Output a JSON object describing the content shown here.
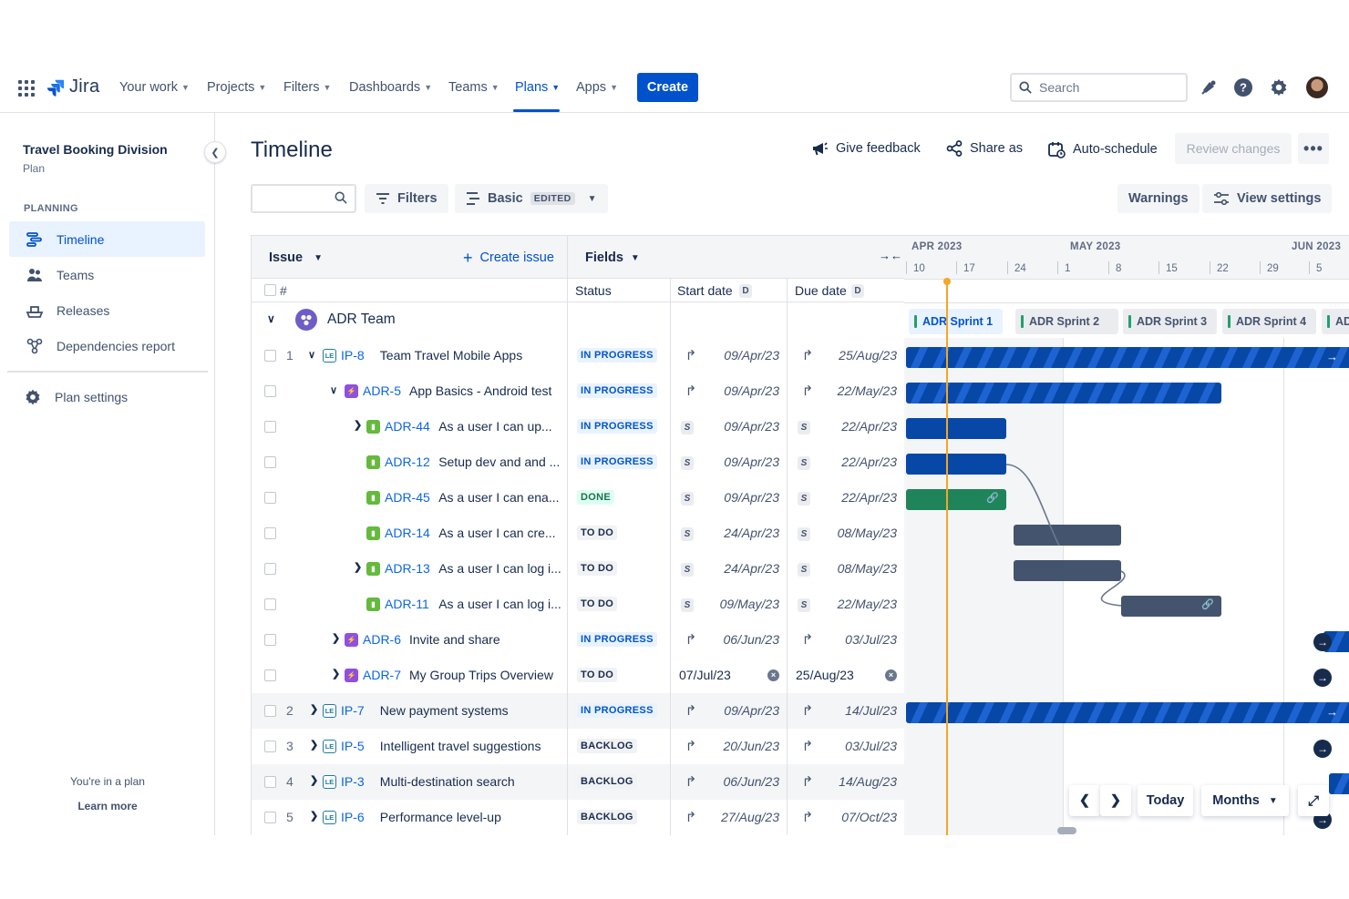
{
  "nav": {
    "app_name": "Jira",
    "items": [
      {
        "label": "Your work"
      },
      {
        "label": "Projects"
      },
      {
        "label": "Filters"
      },
      {
        "label": "Dashboards"
      },
      {
        "label": "Teams"
      },
      {
        "label": "Plans"
      },
      {
        "label": "Apps"
      }
    ],
    "create_label": "Create",
    "search_placeholder": "Search"
  },
  "sidebar": {
    "project_title": "Travel Booking Division",
    "project_type": "Plan",
    "section": "PLANNING",
    "items": [
      {
        "label": "Timeline"
      },
      {
        "label": "Teams"
      },
      {
        "label": "Releases"
      },
      {
        "label": "Dependencies report"
      }
    ],
    "settings_label": "Plan settings",
    "footer_text": "You're in a plan",
    "footer_link": "Learn more"
  },
  "header": {
    "title": "Timeline",
    "give_feedback": "Give feedback",
    "share_as": "Share as",
    "auto_schedule": "Auto-schedule",
    "review_changes": "Review changes",
    "more": "•••"
  },
  "toolbar": {
    "filters": "Filters",
    "view": "Basic",
    "edited": "EDITED",
    "warnings": "Warnings",
    "view_settings": "View settings"
  },
  "table": {
    "issue_header": "Issue",
    "create_issue": "Create issue",
    "fields_header": "Fields",
    "hash": "#",
    "col_status": "Status",
    "col_start": "Start date",
    "col_due": "Due date",
    "date_badge": "D",
    "team_name": "ADR Team",
    "rows": [
      {
        "num": "1",
        "key": "IP-8",
        "title": "Team Travel Mobile Apps",
        "status": "IN PROGRESS",
        "start": "09/Apr/23",
        "due": "25/Aug/23"
      },
      {
        "num": "",
        "key": "ADR-5",
        "title": "App Basics - Android test",
        "status": "IN PROGRESS",
        "start": "09/Apr/23",
        "due": "22/May/23"
      },
      {
        "num": "",
        "key": "ADR-44",
        "title": "As a user I can up...",
        "status": "IN PROGRESS",
        "start": "09/Apr/23",
        "due": "22/Apr/23"
      },
      {
        "num": "",
        "key": "ADR-12",
        "title": "Setup dev and and ...",
        "status": "IN PROGRESS",
        "start": "09/Apr/23",
        "due": "22/Apr/23"
      },
      {
        "num": "",
        "key": "ADR-45",
        "title": "As a user I can ena...",
        "status": "DONE",
        "start": "09/Apr/23",
        "due": "22/Apr/23"
      },
      {
        "num": "",
        "key": "ADR-14",
        "title": "As a user I can cre...",
        "status": "TO DO",
        "start": "24/Apr/23",
        "due": "08/May/23"
      },
      {
        "num": "",
        "key": "ADR-13",
        "title": "As a user I can log i...",
        "status": "TO DO",
        "start": "24/Apr/23",
        "due": "08/May/23"
      },
      {
        "num": "",
        "key": "ADR-11",
        "title": "As a user I can log i...",
        "status": "TO DO",
        "start": "09/May/23",
        "due": "22/May/23"
      },
      {
        "num": "",
        "key": "ADR-6",
        "title": "Invite and share",
        "status": "IN PROGRESS",
        "start": "06/Jun/23",
        "due": "03/Jul/23"
      },
      {
        "num": "",
        "key": "ADR-7",
        "title": "My Group Trips Overview",
        "status": "TO DO",
        "start": "07/Jul/23",
        "due": "25/Aug/23"
      },
      {
        "num": "2",
        "key": "IP-7",
        "title": "New payment systems",
        "status": "IN PROGRESS",
        "start": "09/Apr/23",
        "due": "14/Jul/23"
      },
      {
        "num": "3",
        "key": "IP-5",
        "title": "Intelligent travel suggestions",
        "status": "BACKLOG",
        "start": "20/Jun/23",
        "due": "03/Jul/23"
      },
      {
        "num": "4",
        "key": "IP-3",
        "title": "Multi-destination search",
        "status": "BACKLOG",
        "start": "06/Jun/23",
        "due": "14/Aug/23"
      },
      {
        "num": "5",
        "key": "IP-6",
        "title": "Performance level-up",
        "status": "BACKLOG",
        "start": "27/Aug/23",
        "due": "07/Oct/23"
      }
    ],
    "sprint_flag": "S"
  },
  "timeline": {
    "months": [
      "APR 2023",
      "MAY 2023",
      "JUN 2023"
    ],
    "weeks": [
      "10",
      "17",
      "24",
      "1",
      "8",
      "15",
      "22",
      "29",
      "5"
    ],
    "sprints": [
      "ADR Sprint 1",
      "ADR Sprint 2",
      "ADR Sprint 3",
      "ADR Sprint 4",
      "AD"
    ],
    "today_btn": "Today",
    "scale": "Months"
  },
  "colors": {
    "brand": "#0052cc",
    "bar_blue": "#0747a6",
    "bar_green": "#1f845a",
    "bar_gray": "#44546f",
    "today": "#f5a623"
  }
}
